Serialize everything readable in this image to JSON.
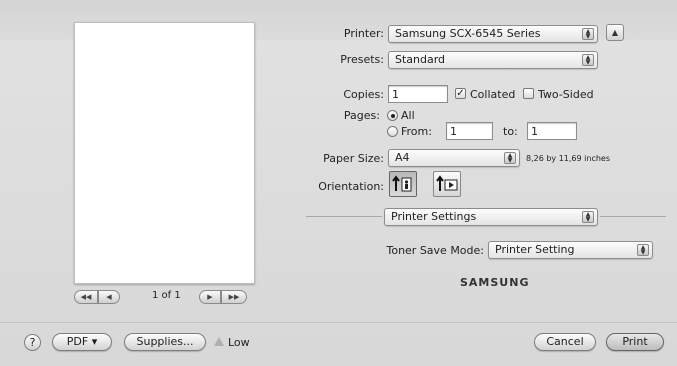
{
  "printer": {
    "label": "Printer:",
    "value": "Samsung SCX-6545 Series",
    "disclosure_icon": "triangle-up"
  },
  "presets": {
    "label": "Presets:",
    "value": "Standard"
  },
  "copies": {
    "label": "Copies:",
    "value": "1",
    "collated_label": "Collated",
    "collated": true,
    "two_sided_label": "Two-Sided",
    "two_sided": false
  },
  "pages": {
    "label": "Pages:",
    "all_label": "All",
    "from_label": "From:",
    "from_value": "1",
    "to_label": "to:",
    "to_value": "1",
    "selected": "All"
  },
  "paper_size": {
    "label": "Paper Size:",
    "value": "A4",
    "dimensions": "8,26 by 11,69 inches"
  },
  "orientation": {
    "label": "Orientation:",
    "selected": "portrait"
  },
  "section": {
    "value": "Printer Settings"
  },
  "toner": {
    "label": "Toner Save Mode:",
    "value": "Printer Setting"
  },
  "brand": "SAMSUNG",
  "preview": {
    "page_count": "1 of 1",
    "first": "◀◀",
    "prev": "◀",
    "next": "▶",
    "last": "▶▶"
  },
  "footer": {
    "help": "?",
    "pdf": "PDF ▾",
    "supplies": "Supplies...",
    "supply_level": "Low",
    "cancel": "Cancel",
    "print": "Print"
  }
}
